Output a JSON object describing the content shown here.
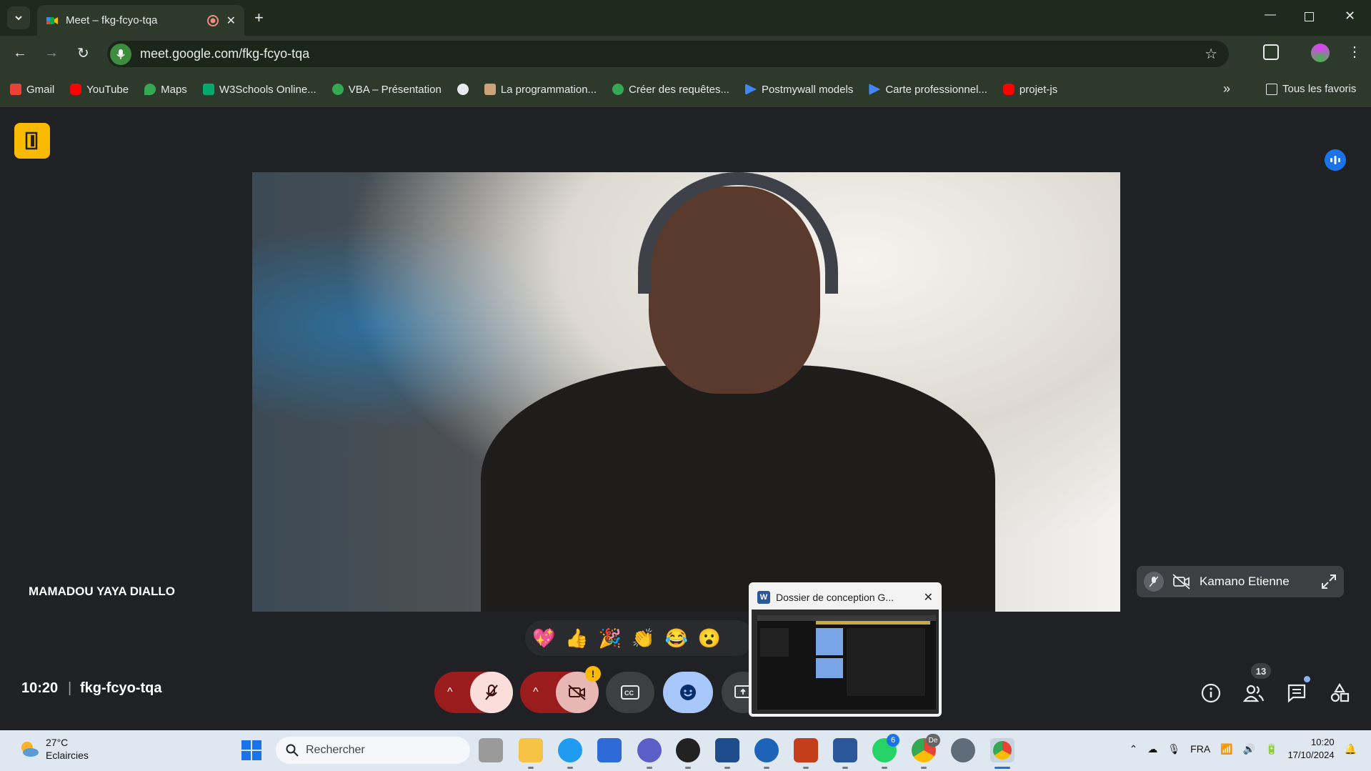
{
  "browser": {
    "tab_title": "Meet – fkg-fcyo-tqa",
    "url": "meet.google.com/fkg-fcyo-tqa",
    "bookmarks": [
      {
        "label": "Gmail",
        "icon": "gmail-icon",
        "color": "#ea4335"
      },
      {
        "label": "YouTube",
        "icon": "youtube-icon",
        "color": "#ff0000"
      },
      {
        "label": "Maps",
        "icon": "maps-icon",
        "color": "#34a853"
      },
      {
        "label": "W3Schools Online...",
        "icon": "w3schools-icon",
        "color": "#04aa6d"
      },
      {
        "label": "VBA – Présentation",
        "icon": "vba-icon",
        "color": "#34a853"
      },
      {
        "label": "",
        "icon": "globe-icon",
        "color": "#e8eaed"
      },
      {
        "label": "La programmation...",
        "icon": "page-icon",
        "color": "#c9a37a"
      },
      {
        "label": "Créer des requêtes...",
        "icon": "query-icon",
        "color": "#34a853"
      },
      {
        "label": "Postmywall models",
        "icon": "postmywall-icon",
        "color": "#4285f4"
      },
      {
        "label": "Carte professionnel...",
        "icon": "card-icon",
        "color": "#4285f4"
      },
      {
        "label": "projet-js",
        "icon": "youtube-icon",
        "color": "#ff0000"
      }
    ],
    "all_bookmarks": "Tous les favoris"
  },
  "meet": {
    "main_participant": "MAMADOU YAYA DIALLO",
    "second_participant": "Kamano Etienne",
    "time": "10:20",
    "meeting_code": "fkg-fcyo-tqa",
    "participants_count": "13",
    "reactions": [
      "💖",
      "👍",
      "🎉",
      "👏",
      "😂",
      "😮"
    ]
  },
  "popup": {
    "title": "Dossier de conception G..."
  },
  "taskbar": {
    "weather_temp": "27°C",
    "weather_desc": "Eclaircies",
    "search_placeholder": "Rechercher",
    "whatsapp_badge": "6",
    "chrome_badge": "De",
    "lang": "FRA",
    "time": "10:20",
    "date": "17/10/2024"
  }
}
